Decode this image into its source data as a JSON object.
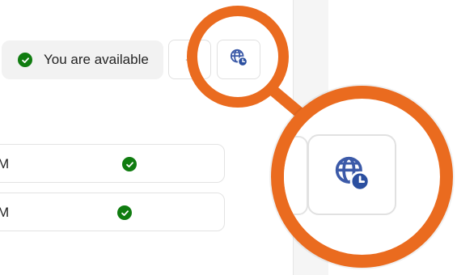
{
  "status": {
    "label": "You are available",
    "state_color": "#107c10"
  },
  "toolbar": {
    "buttons": [
      {
        "icon": "partial-icon"
      },
      {
        "icon": "globe-clock-icon"
      }
    ]
  },
  "list": {
    "rows": [
      {
        "label": "M",
        "status_icon": "available-check-icon"
      },
      {
        "label": "M",
        "status_icon": "available-check-icon"
      }
    ]
  },
  "callout": {
    "accent_color": "#ea6b1f",
    "magnified_icon": "globe-clock-icon"
  }
}
